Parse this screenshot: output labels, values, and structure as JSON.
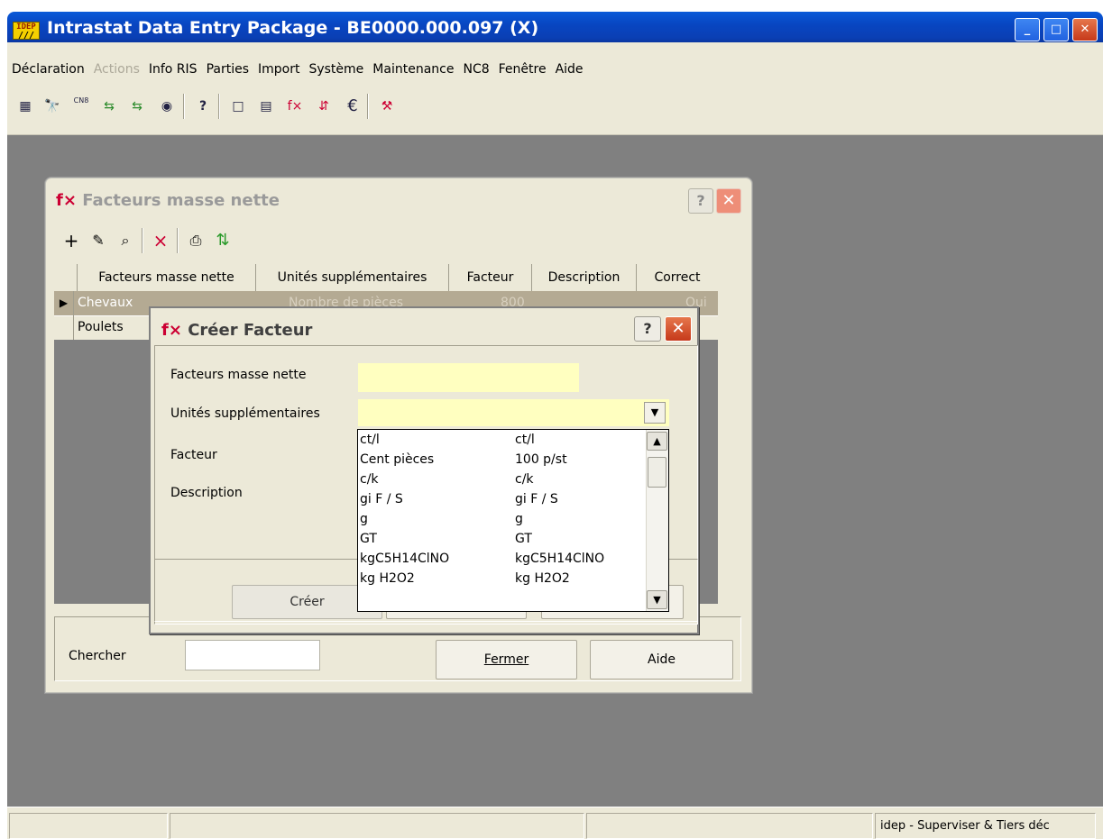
{
  "app": {
    "title": "Intrastat Data Entry Package - BE0000.000.097 (X)",
    "logo_text": "IDEP"
  },
  "menu": [
    "Déclaration",
    "Actions",
    "Info RIS",
    "Parties",
    "Import",
    "Système",
    "Maintenance",
    "NC8",
    "Fenêtre",
    "Aide"
  ],
  "toolbar_icons": [
    {
      "name": "table-icon",
      "glyph": "▦"
    },
    {
      "name": "binoculars-icon",
      "glyph": "🔭"
    },
    {
      "name": "cn8-nc8-icon",
      "glyph": "CN8"
    },
    {
      "name": "send-icon",
      "glyph": "⇆"
    },
    {
      "name": "receive-icon",
      "glyph": "⇆"
    },
    {
      "name": "camera-icon",
      "glyph": "◉"
    },
    {
      "name": "help-book-icon",
      "glyph": "?"
    },
    {
      "name": "new-document-icon",
      "glyph": "□"
    },
    {
      "name": "xiii-icon",
      "glyph": "▤"
    },
    {
      "name": "function-icon",
      "glyph": "f×"
    },
    {
      "name": "counter-icon",
      "glyph": "⇵"
    },
    {
      "name": "euro-icon",
      "glyph": "€"
    },
    {
      "name": "tools-icon",
      "glyph": "⚒"
    }
  ],
  "factors_window": {
    "title": "Facteurs masse nette",
    "columns": [
      "Facteurs masse nette",
      "Unités supplémentaires",
      "Facteur",
      "Description",
      "Correct"
    ],
    "rows": [
      {
        "name": "Chevaux",
        "units": "Nombre de pièces",
        "factor": "800",
        "description": "",
        "correct": "Oui"
      },
      {
        "name": "Poulets",
        "units": "",
        "factor": "",
        "description": "",
        "correct": ""
      }
    ],
    "search_label": "Chercher",
    "search_value": "",
    "close_label": "Fermer",
    "help_label": "Aide"
  },
  "create_dialog": {
    "title": "Créer Facteur",
    "labels": {
      "net_mass": "Facteurs masse nette",
      "units": "Unités supplémentaires",
      "factor": "Facteur",
      "description": "Description"
    },
    "net_mass_value": "",
    "units_value": "",
    "create_label": "Créer"
  },
  "units_list": [
    [
      "ct/l",
      "ct/l"
    ],
    [
      "Cent pièces",
      "100 p/st"
    ],
    [
      "c/k",
      "c/k"
    ],
    [
      "gi F / S",
      "gi F / S"
    ],
    [
      "g",
      "g"
    ],
    [
      "GT",
      "GT"
    ],
    [
      "kgC5H14ClNO",
      "kgC5H14ClNO"
    ],
    [
      "kg H2O2",
      "kg H2O2"
    ]
  ],
  "status_bar": [
    "",
    "",
    "",
    "idep - Superviser & Tiers déc"
  ],
  "colors": {
    "titlebar": "#0a5ad8",
    "chrome": "#ece9d8",
    "workspace": "#808080",
    "mandatory_field": "#ffffc0",
    "selected_row": "#b4aa93"
  }
}
